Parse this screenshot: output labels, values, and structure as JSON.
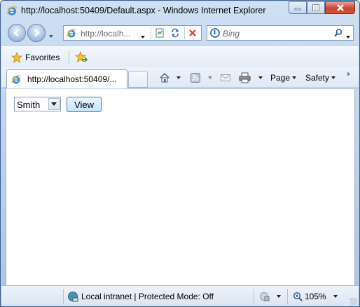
{
  "window": {
    "title": "http://localhost:50409/Default.aspx - Windows Internet Explorer"
  },
  "address_bar": {
    "url": "http://localh..."
  },
  "search_box": {
    "placeholder": "Bing"
  },
  "favorites_bar": {
    "favorites_label": "Favorites"
  },
  "tabs": [
    {
      "label": "http://localhost:50409/..."
    }
  ],
  "command_bar": {
    "page_label": "Page",
    "safety_label": "Safety"
  },
  "page": {
    "select_value": "Smith",
    "view_button_label": "View"
  },
  "status_bar": {
    "zone_text": "Local intranet | Protected Mode: Off",
    "zoom_text": "105%"
  },
  "colors": {
    "frame": "#b9cfea",
    "close_button": "#c7452e",
    "view_button": "#bee6fd"
  }
}
